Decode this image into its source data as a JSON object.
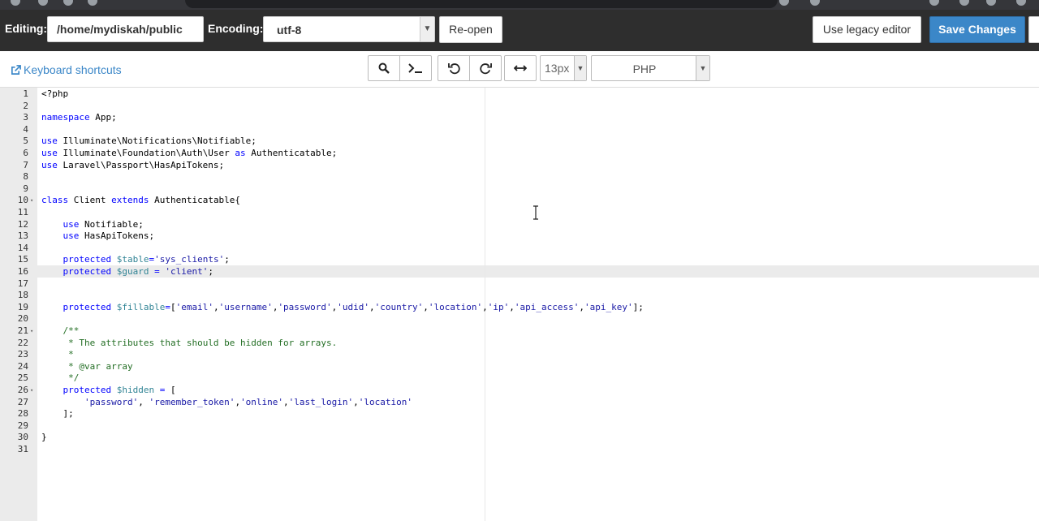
{
  "toolbar": {
    "editing_label": "Editing:",
    "path_value": "/home/mydiskah/public",
    "encoding_label": "Encoding:",
    "encoding_value": "utf-8",
    "reopen_label": "Re-open",
    "legacy_label": "Use legacy editor",
    "save_label": "Save Changes"
  },
  "editor_toolbar": {
    "shortcuts_label": "Keyboard shortcuts",
    "font_size": "13px",
    "language": "PHP"
  },
  "colors": {
    "accent": "#3b87c8",
    "keyword": "#0000ff",
    "variable": "#318495",
    "string": "#1a1aa6",
    "comment": "#236e24"
  },
  "code": {
    "active_line": 16,
    "lines": [
      {
        "n": "1",
        "fold": "",
        "tokens": [
          [
            "",
            "<?php"
          ]
        ]
      },
      {
        "n": "2",
        "fold": "",
        "tokens": []
      },
      {
        "n": "3",
        "fold": "",
        "tokens": [
          [
            "kw",
            "namespace"
          ],
          [
            "",
            " App;"
          ]
        ]
      },
      {
        "n": "4",
        "fold": "",
        "tokens": []
      },
      {
        "n": "5",
        "fold": "",
        "tokens": [
          [
            "kw",
            "use"
          ],
          [
            "",
            " Illuminate\\Notifications\\Notifiable;"
          ]
        ]
      },
      {
        "n": "6",
        "fold": "",
        "tokens": [
          [
            "kw",
            "use"
          ],
          [
            "",
            " Illuminate\\Foundation\\Auth\\User "
          ],
          [
            "kw",
            "as"
          ],
          [
            "",
            " Authenticatable;"
          ]
        ]
      },
      {
        "n": "7",
        "fold": "",
        "tokens": [
          [
            "kw",
            "use"
          ],
          [
            "",
            " Laravel\\Passport\\HasApiTokens;"
          ]
        ]
      },
      {
        "n": "8",
        "fold": "",
        "tokens": []
      },
      {
        "n": "9",
        "fold": "",
        "tokens": []
      },
      {
        "n": "10",
        "fold": "▾",
        "tokens": [
          [
            "kw",
            "class"
          ],
          [
            "",
            " Client "
          ],
          [
            "kw",
            "extends"
          ],
          [
            "",
            " Authenticatable{"
          ]
        ]
      },
      {
        "n": "11",
        "fold": "",
        "tokens": []
      },
      {
        "n": "12",
        "fold": "",
        "tokens": [
          [
            "",
            "    "
          ],
          [
            "kw",
            "use"
          ],
          [
            "",
            " Notifiable;"
          ]
        ]
      },
      {
        "n": "13",
        "fold": "",
        "tokens": [
          [
            "",
            "    "
          ],
          [
            "kw",
            "use"
          ],
          [
            "",
            " HasApiTokens;"
          ]
        ]
      },
      {
        "n": "14",
        "fold": "",
        "tokens": []
      },
      {
        "n": "15",
        "fold": "",
        "tokens": [
          [
            "",
            "    "
          ],
          [
            "kw",
            "protected"
          ],
          [
            "",
            " "
          ],
          [
            "var",
            "$table"
          ],
          [
            "kw",
            "="
          ],
          [
            "str",
            "'sys_clients'"
          ],
          [
            "",
            ";"
          ]
        ]
      },
      {
        "n": "16",
        "fold": "",
        "tokens": [
          [
            "",
            "    "
          ],
          [
            "kw",
            "protected"
          ],
          [
            "",
            " "
          ],
          [
            "var",
            "$guard"
          ],
          [
            "",
            " "
          ],
          [
            "kw",
            "="
          ],
          [
            "",
            " "
          ],
          [
            "str",
            "'client'"
          ],
          [
            "",
            ";"
          ]
        ]
      },
      {
        "n": "17",
        "fold": "",
        "tokens": []
      },
      {
        "n": "18",
        "fold": "",
        "tokens": []
      },
      {
        "n": "19",
        "fold": "",
        "tokens": [
          [
            "",
            "    "
          ],
          [
            "kw",
            "protected"
          ],
          [
            "",
            " "
          ],
          [
            "var",
            "$fillable"
          ],
          [
            "kw",
            "="
          ],
          [
            "",
            "["
          ],
          [
            "str",
            "'email'"
          ],
          [
            "",
            ","
          ],
          [
            "str",
            "'username'"
          ],
          [
            "",
            ","
          ],
          [
            "str",
            "'password'"
          ],
          [
            "",
            ","
          ],
          [
            "str",
            "'udid'"
          ],
          [
            "",
            ","
          ],
          [
            "str",
            "'country'"
          ],
          [
            "",
            ","
          ],
          [
            "str",
            "'location'"
          ],
          [
            "",
            ","
          ],
          [
            "str",
            "'ip'"
          ],
          [
            "",
            ","
          ],
          [
            "str",
            "'api_access'"
          ],
          [
            "",
            ","
          ],
          [
            "str",
            "'api_key'"
          ],
          [
            "",
            "];"
          ]
        ]
      },
      {
        "n": "20",
        "fold": "",
        "tokens": []
      },
      {
        "n": "21",
        "fold": "▾",
        "tokens": [
          [
            "",
            "    "
          ],
          [
            "cmt",
            "/**"
          ]
        ]
      },
      {
        "n": "22",
        "fold": "",
        "tokens": [
          [
            "",
            "     "
          ],
          [
            "cmt",
            "* The attributes that should be hidden for arrays."
          ]
        ]
      },
      {
        "n": "23",
        "fold": "",
        "tokens": [
          [
            "",
            "     "
          ],
          [
            "cmt",
            "*"
          ]
        ]
      },
      {
        "n": "24",
        "fold": "",
        "tokens": [
          [
            "",
            "     "
          ],
          [
            "cmt",
            "* @var array"
          ]
        ]
      },
      {
        "n": "25",
        "fold": "",
        "tokens": [
          [
            "",
            "     "
          ],
          [
            "cmt",
            "*/"
          ]
        ]
      },
      {
        "n": "26",
        "fold": "▾",
        "tokens": [
          [
            "",
            "    "
          ],
          [
            "kw",
            "protected"
          ],
          [
            "",
            " "
          ],
          [
            "var",
            "$hidden"
          ],
          [
            "",
            " "
          ],
          [
            "kw",
            "="
          ],
          [
            "",
            " ["
          ]
        ]
      },
      {
        "n": "27",
        "fold": "",
        "tokens": [
          [
            "",
            "        "
          ],
          [
            "str",
            "'password'"
          ],
          [
            "",
            ", "
          ],
          [
            "str",
            "'remember_token'"
          ],
          [
            "",
            ","
          ],
          [
            "str",
            "'online'"
          ],
          [
            "",
            ","
          ],
          [
            "str",
            "'last_login'"
          ],
          [
            "",
            ","
          ],
          [
            "str",
            "'location'"
          ]
        ]
      },
      {
        "n": "28",
        "fold": "",
        "tokens": [
          [
            "",
            "    ];"
          ]
        ]
      },
      {
        "n": "29",
        "fold": "",
        "tokens": []
      },
      {
        "n": "30",
        "fold": "",
        "tokens": [
          [
            "",
            "}"
          ]
        ]
      },
      {
        "n": "31",
        "fold": "",
        "tokens": []
      }
    ]
  }
}
